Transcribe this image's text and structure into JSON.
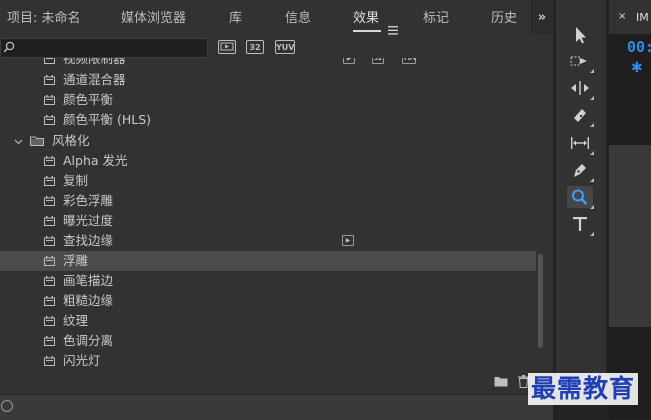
{
  "tabs": [
    {
      "label": "项目: 未命名",
      "active": false
    },
    {
      "label": "媒体浏览器",
      "active": false
    },
    {
      "label": "库",
      "active": false
    },
    {
      "label": "信息",
      "active": false
    },
    {
      "label": "效果",
      "active": true
    },
    {
      "label": "标记",
      "active": false
    },
    {
      "label": "历史",
      "active": false
    }
  ],
  "tab_menu_icon": "hamburger-icon",
  "tab_overflow": "»",
  "search": {
    "value": "",
    "icon": "search-icon"
  },
  "filters": [
    "32",
    "YUV"
  ],
  "effects": [
    {
      "label": "视频限制器",
      "type": "effect",
      "badges": [
        "accelerated",
        "32",
        "YUV"
      ]
    },
    {
      "label": "通道混合器",
      "type": "effect",
      "badges": []
    },
    {
      "label": "颜色平衡",
      "type": "effect",
      "badges": []
    },
    {
      "label": "颜色平衡 (HLS)",
      "type": "effect",
      "badges": []
    },
    {
      "label": "风格化",
      "type": "folder",
      "expanded": true,
      "badges": []
    },
    {
      "label": "Alpha 发光",
      "type": "effect",
      "badges": []
    },
    {
      "label": "复制",
      "type": "effect",
      "badges": []
    },
    {
      "label": "彩色浮雕",
      "type": "effect",
      "badges": []
    },
    {
      "label": "曝光过度",
      "type": "effect",
      "badges": []
    },
    {
      "label": "查找边缘",
      "type": "effect",
      "badges": [
        "accelerated"
      ]
    },
    {
      "label": "浮雕",
      "type": "effect",
      "selected": true,
      "badges": []
    },
    {
      "label": "画笔描边",
      "type": "effect",
      "badges": []
    },
    {
      "label": "粗糙边缘",
      "type": "effect",
      "badges": []
    },
    {
      "label": "纹理",
      "type": "effect",
      "badges": []
    },
    {
      "label": "色调分离",
      "type": "effect",
      "badges": []
    },
    {
      "label": "闪光灯",
      "type": "effect",
      "badges": []
    }
  ],
  "bottom_icons": [
    "new-folder-icon",
    "trash-icon"
  ],
  "tools": [
    {
      "name": "selection-tool",
      "active": false
    },
    {
      "name": "track-select-tool",
      "active": false
    },
    {
      "name": "ripple-edit-tool",
      "active": false
    },
    {
      "name": "razor-tool",
      "active": false
    },
    {
      "name": "slip-tool",
      "active": false
    },
    {
      "name": "pen-tool",
      "active": false
    },
    {
      "name": "zoom-tool",
      "active": true
    },
    {
      "name": "type-tool",
      "active": false
    }
  ],
  "monitor": {
    "close": "×",
    "tab_label": "IM",
    "timecode": "00:",
    "star": "✱"
  },
  "watermark": "最需教育",
  "colors": {
    "accent": "#2d8ceb",
    "panel": "#323232",
    "selected_row": "#4b4b4b",
    "watermark": "#1f3fb2"
  }
}
